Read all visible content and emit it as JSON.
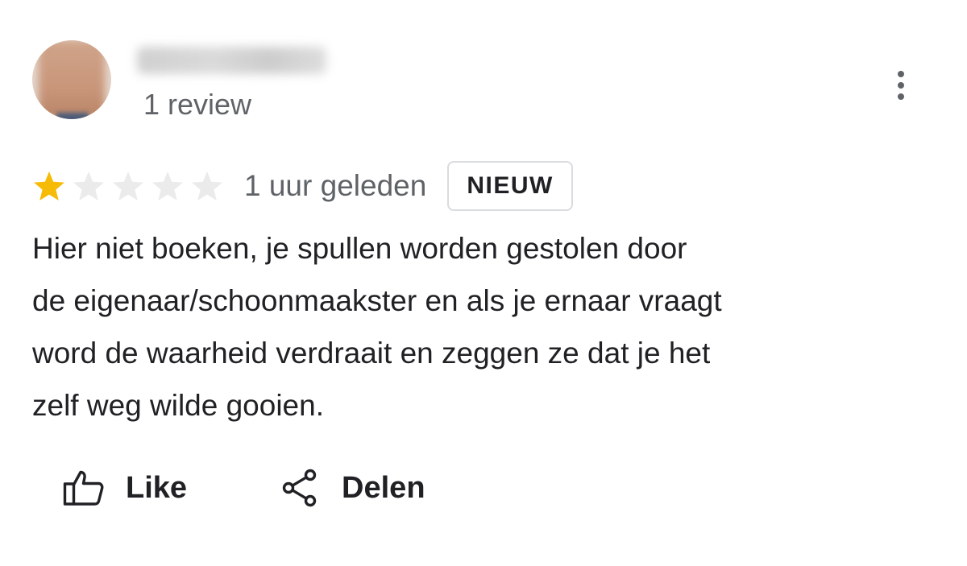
{
  "reviewer": {
    "review_count": "1 review"
  },
  "review": {
    "rating": 1,
    "max_rating": 5,
    "star_filled_color": "#f6bb06",
    "star_empty_color": "#ebebeb",
    "time_ago": "1 uur geleden",
    "badge": "NIEUW",
    "text_lines": [
      "Hier niet boeken, je spullen worden gestolen door",
      "de eigenaar/schoonmaakster en als je ernaar vraagt",
      "word de waarheid verdraait en zeggen ze dat je het",
      "zelf weg wilde gooien."
    ]
  },
  "actions": {
    "like_label": "Like",
    "like_icon": "thumbs-up-icon",
    "share_label": "Delen",
    "share_icon": "share-icon"
  },
  "menu": {
    "icon": "more-vertical-icon"
  }
}
